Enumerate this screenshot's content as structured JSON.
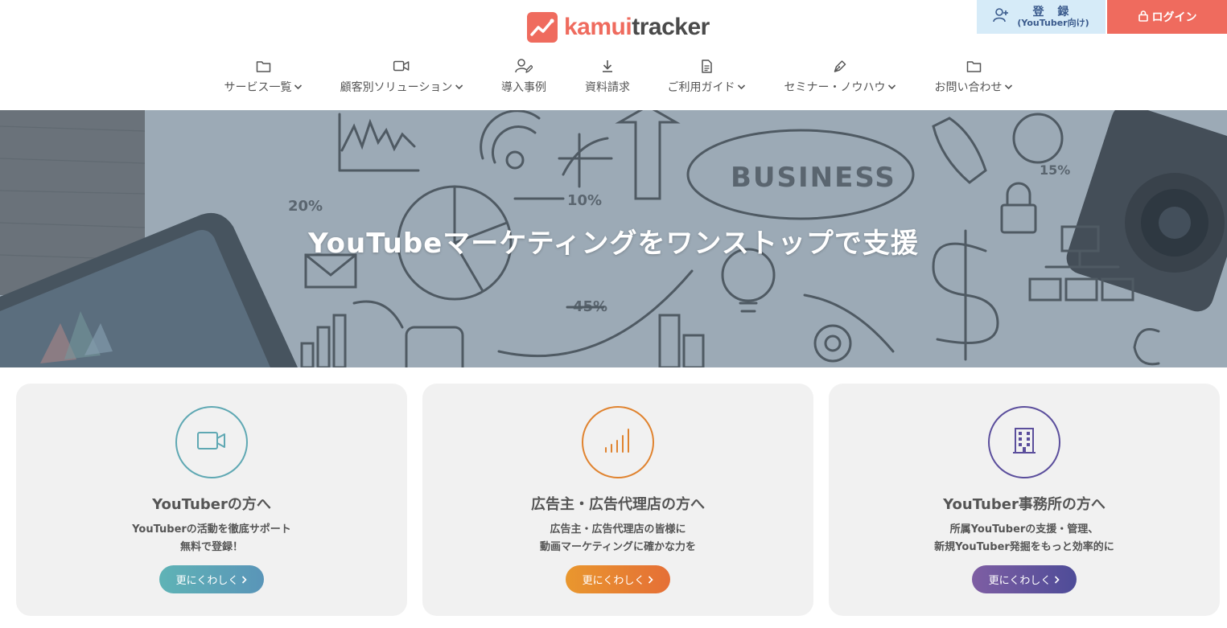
{
  "header": {
    "logo": {
      "text_accent": "kamui",
      "text_main": "tracker"
    },
    "register": {
      "label": "登 録",
      "sub_label": "(YouTuber向け)",
      "icon": "user-plus-icon"
    },
    "login": {
      "label": "ログイン",
      "icon": "lock-icon"
    }
  },
  "nav": {
    "items": [
      {
        "label": "サービス一覧",
        "icon": "folder-icon",
        "dropdown": true
      },
      {
        "label": "顧客別ソリューション",
        "icon": "video-icon",
        "dropdown": true
      },
      {
        "label": "導入事例",
        "icon": "user-edit-icon",
        "dropdown": false
      },
      {
        "label": "資料請求",
        "icon": "download-icon",
        "dropdown": false
      },
      {
        "label": "ご利用ガイド",
        "icon": "document-icon",
        "dropdown": true
      },
      {
        "label": "セミナー・ノウハウ",
        "icon": "pen-icon",
        "dropdown": true
      },
      {
        "label": "お問い合わせ",
        "icon": "folder-icon",
        "dropdown": true
      }
    ]
  },
  "hero": {
    "title": "YouTubeマーケティングをワンストップで支援",
    "sketch": {
      "business": "BUSINESS",
      "p20": "20%",
      "p10": "10%",
      "p45": "45%",
      "p15": "15%"
    }
  },
  "cards": [
    {
      "title": "YouTuberの方へ",
      "desc_line1": "YouTuberの活動を徹底サポート",
      "desc_line2": "無料で登録！",
      "button": "更にくわしく",
      "icon": "video-camera-icon",
      "color": "#5fa8b3"
    },
    {
      "title": "広告主・広告代理店の方へ",
      "desc_line1": "広告主・広告代理店の皆様に",
      "desc_line2": "動画マーケティングに確かな力を",
      "button": "更にくわしく",
      "icon": "signal-bars-icon",
      "color": "#e0832f"
    },
    {
      "title": "YouTuber事務所の方へ",
      "desc_line1": "所属YouTuberの支援・管理、",
      "desc_line2": "新規YouTuber発掘をもっと効率的に",
      "button": "更にくわしく",
      "icon": "building-icon",
      "color": "#5b4e9c"
    }
  ],
  "colors": {
    "brand": "#ef6b5e",
    "register_bg": "#d6ebf8",
    "card_bg": "#f1f1f1"
  }
}
